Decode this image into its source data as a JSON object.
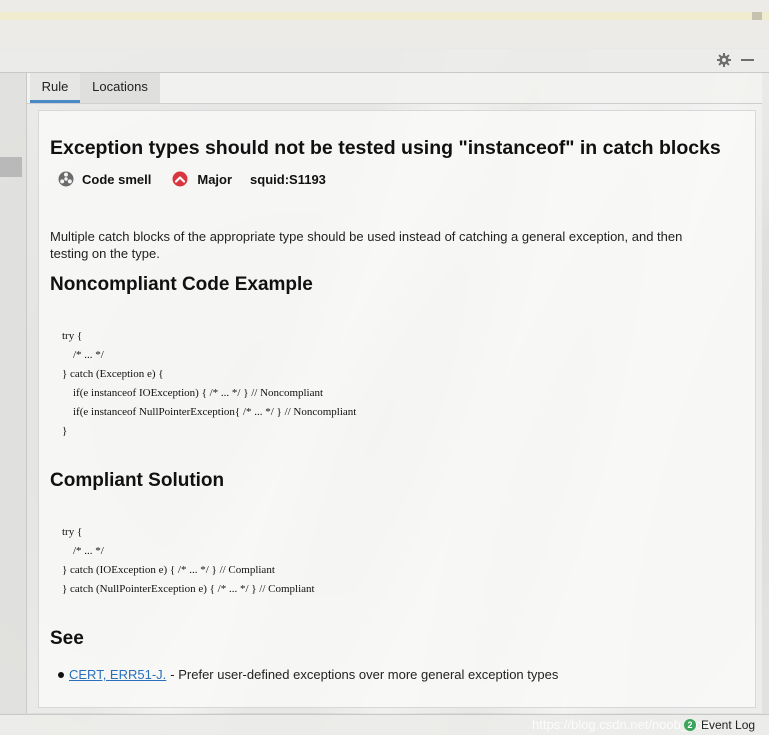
{
  "tabs": [
    {
      "label": "Rule",
      "active": true
    },
    {
      "label": "Locations",
      "active": false
    }
  ],
  "header": {
    "settings_icon": "gear-icon",
    "minimize_icon": "minimize-icon"
  },
  "rule": {
    "title": "Exception types should not be tested using \"instanceof\" in catch blocks",
    "type": {
      "icon": "code-smell-icon",
      "label": "Code smell"
    },
    "severity": {
      "icon": "major-severity-icon",
      "label": "Major",
      "color": "#d9363e"
    },
    "key": "squid:S1193",
    "description": "Multiple catch blocks of the appropriate type should be used instead of catching a general exception, and then testing on the type."
  },
  "noncompliant": {
    "title": "Noncompliant Code Example",
    "code": "try {\n    /* ... */\n} catch (Exception e) {\n    if(e instanceof IOException) { /* ... */ } // Noncompliant\n    if(e instanceof NullPointerException{ /* ... */ } // Noncompliant\n}"
  },
  "compliant": {
    "title": "Compliant Solution",
    "code": "try {\n    /* ... */\n} catch (IOException e) { /* ... */ } // Compliant\n} catch (NullPointerException e) { /* ... */ } // Compliant"
  },
  "see": {
    "title": "See",
    "items": [
      {
        "link": "CERT, ERR51-J.",
        "text": "- Prefer user-defined exceptions over more general exception types"
      }
    ]
  },
  "status_bar": {
    "watermark": "https://blog.csdn.net/noob_node",
    "event_log_label": "Event Log",
    "event_log_count": "2",
    "event_log_color": "#3aa55b"
  }
}
